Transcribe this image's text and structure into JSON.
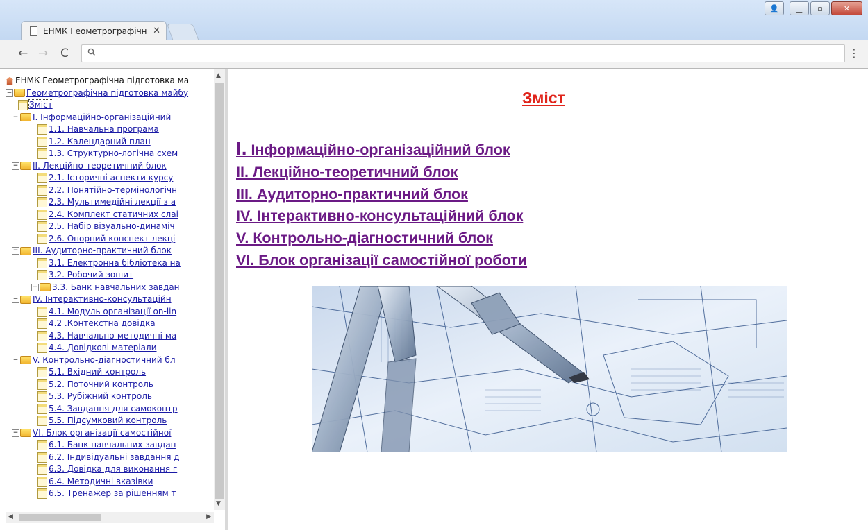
{
  "browser": {
    "tab_title": "ЕНМК Геометрографічн",
    "tab_close": "✕",
    "nav": {
      "back": "←",
      "forward": "→",
      "reload": "C"
    },
    "menu": "⋮",
    "omnibox_icon": "search-icon"
  },
  "tree": {
    "root_label": "ЕНМК Геометрографічна підготовка ма",
    "course_label": "Геометрографічна підготовка майбу",
    "contents_label": "Зміст",
    "sections": [
      {
        "label": "I. Інформаційно-організаційний",
        "items": [
          "1.1. Навчальна програма",
          "1.2. Календарний план",
          "1.3. Структурно-логічна схем"
        ]
      },
      {
        "label": "II. Лекційно-теоретичний блок",
        "items": [
          "2.1. Історичні аспекти курсу",
          "2.2. Понятійно-термінологічн",
          "2.3. Мультимедійні лекції з а",
          "2.4. Комплект статичних слаі",
          "2.5. Набір візуально-динаміч",
          "2.6. Опорний конспект лекці"
        ]
      },
      {
        "label": "III. Аудиторно-практичний блок",
        "items": [
          "3.1. Електронна бібліотека на",
          "3.2. Робочий зошит",
          "3.3. Банк навчальних завдан"
        ]
      },
      {
        "label": "IV. Інтерактивно-консультаційн",
        "items": [
          "4.1. Модуль організації on-lin",
          "4.2 .Контекстна довідка",
          "4.3. Навчально-методичні ма",
          "4.4. Довідкові матеріали"
        ]
      },
      {
        "label": "V. Контрольно-діагностичний бл",
        "items": [
          "5.1. Вхідний контроль",
          "5.2. Поточний контроль",
          "5.3. Рубіжний контроль",
          "5.4. Завдання для самоконтр",
          "5.5. Підсумковий контроль"
        ]
      },
      {
        "label": "VI. Блок організації самостійної",
        "items": [
          "6.1. Банк навчальних завдан",
          "6.2. Індивідуальні завдання д",
          "6.3. Довідка для виконання г",
          "6.4. Методичні вказівки",
          "6.5. Тренажер за рішенням т"
        ]
      }
    ]
  },
  "main": {
    "heading": "Зміст",
    "blocks": [
      "I. Інформаційно-організаційний блок",
      "II. Лекційно-теоретичний блок",
      "III. Аудиторно-практичний блок",
      "IV. Інтерактивно-консультаційний блок",
      "V. Контрольно-діагностичний блок",
      "VI. Блок організації самостійної роботи"
    ]
  },
  "colors": {
    "heading": "#e0241b",
    "link_visited": "#6b1a85",
    "tree_link": "#1a1aa6"
  }
}
